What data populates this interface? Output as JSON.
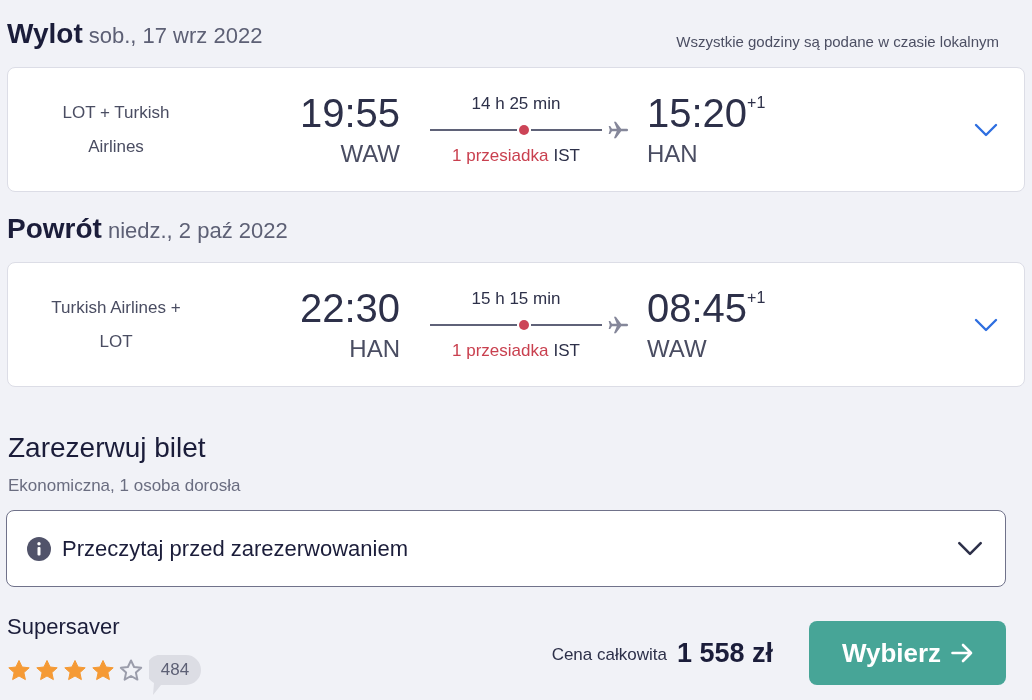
{
  "note": "Wszystkie godziny są podane w czasie lokalnym",
  "legs": [
    {
      "label": "Wylot",
      "date": "sob., 17 wrz 2022",
      "airline": "LOT + Turkish Airlines",
      "depart_time": "19:55",
      "depart_airport": "WAW",
      "duration": "14 h 25 min",
      "stops": "1 przesiadka",
      "via": "IST",
      "arrive_time": "15:20",
      "arrive_offset": "+1",
      "arrive_airport": "HAN",
      "expanded": false
    },
    {
      "label": "Powrót",
      "date": "niedz., 2 paź 2022",
      "airline": "Turkish Airlines + LOT",
      "depart_time": "22:30",
      "depart_airport": "HAN",
      "duration": "15 h 15 min",
      "stops": "1 przesiadka",
      "via": "IST",
      "arrive_time": "08:45",
      "arrive_offset": "+1",
      "arrive_airport": "WAW",
      "expanded": false
    }
  ],
  "booking": {
    "title": "Zarezerwuj bilet",
    "subtitle": "Ekonomiczna, 1 osoba dorosła",
    "notice": {
      "label": "Przeczytaj przed zarezerwowaniem",
      "expanded": false
    },
    "fare": {
      "name": "Supersaver",
      "stars": 4,
      "reviews": "484"
    },
    "price_label": "Cena całkowita",
    "price": "1 558 zł",
    "button": "Wybierz"
  }
}
